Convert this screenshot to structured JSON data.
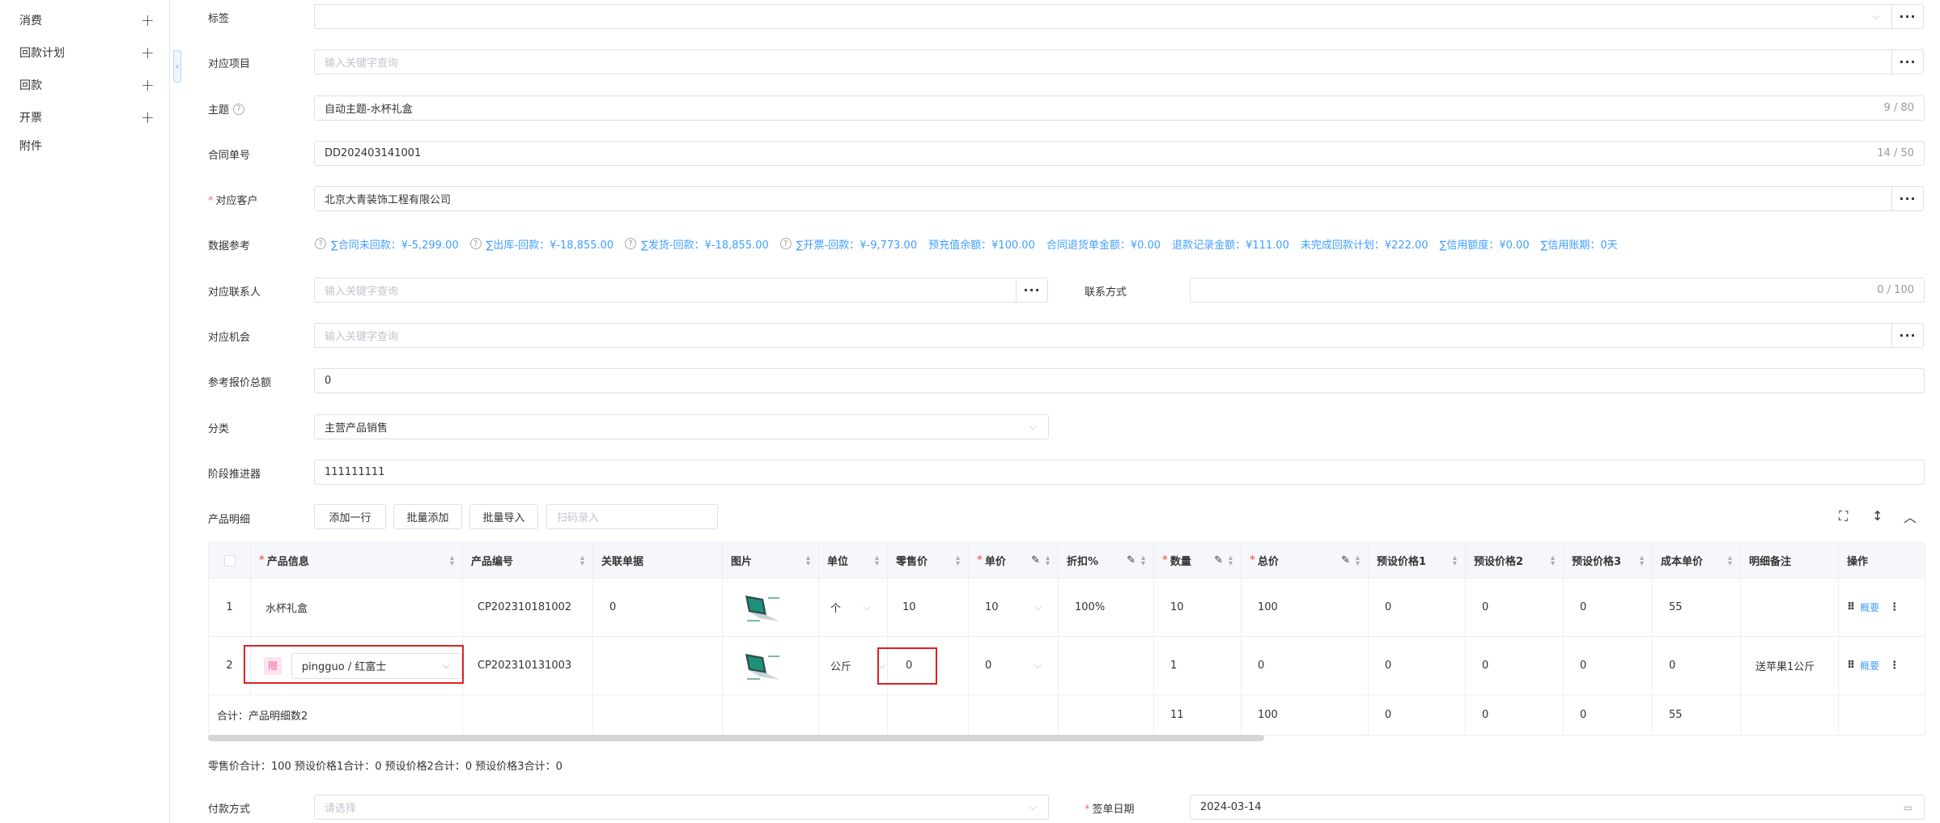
{
  "sidebar": {
    "items": [
      {
        "label": "消费",
        "has_plus": true
      },
      {
        "label": "回款计划",
        "has_plus": true
      },
      {
        "label": "回款",
        "has_plus": true
      },
      {
        "label": "开票",
        "has_plus": true
      },
      {
        "label": "附件",
        "has_plus": false
      }
    ],
    "collapse_glyph": "‹"
  },
  "form": {
    "tag": {
      "label": "标签",
      "value": ""
    },
    "project": {
      "label": "对应项目",
      "placeholder": "输入关键字查询"
    },
    "subject": {
      "label": "主题",
      "value": "自动主题-水杯礼盒",
      "count": "9 / 80"
    },
    "contract_no": {
      "label": "合同单号",
      "value": "DD202403141001",
      "count": "14 / 50"
    },
    "customer": {
      "label": "对应客户",
      "value": "北京大青装饰工程有限公司"
    },
    "data_ref": {
      "label": "数据参考",
      "items": [
        {
          "text": "∑合同未回款：¥-5,299.00",
          "help": true
        },
        {
          "text": "∑出库-回款：¥-18,855.00",
          "help": true
        },
        {
          "text": "∑发货-回款：¥-18,855.00",
          "help": true
        },
        {
          "text": "∑开票-回款：¥-9,773.00",
          "help": true
        },
        {
          "text": "预充值余额：¥100.00",
          "help": false
        },
        {
          "text": "合同退货单金额：¥0.00",
          "help": false
        },
        {
          "text": "退款记录金额：¥111.00",
          "help": false
        },
        {
          "text": "未完成回款计划：¥222.00",
          "help": false
        },
        {
          "text": "∑信用额度：¥0.00",
          "help": false
        },
        {
          "text": "∑信用账期：0天",
          "help": false
        }
      ]
    },
    "contact": {
      "label": "对应联系人",
      "placeholder": "输入关键字查询"
    },
    "contact_method": {
      "label": "联系方式",
      "value": "",
      "count": "0 / 100"
    },
    "opportunity": {
      "label": "对应机会",
      "placeholder": "输入关键字查询"
    },
    "ref_quote_total": {
      "label": "参考报价总额",
      "value": "0"
    },
    "category": {
      "label": "分类",
      "value": "主营产品销售"
    },
    "stage": {
      "label": "阶段推进器",
      "value": "111111111"
    },
    "products_label": "产品明细",
    "payment": {
      "label": "付款方式",
      "placeholder": "请选择"
    },
    "sign_date": {
      "label": "签单日期",
      "value": "2024-03-14"
    }
  },
  "toolbar": {
    "add_row": "添加一行",
    "batch_add": "批量添加",
    "batch_import": "批量导入",
    "scan_placeholder": "扫码录入"
  },
  "table": {
    "headers": {
      "product_info": "产品信息",
      "product_code": "产品编号",
      "related_doc": "关联单据",
      "image": "图片",
      "unit": "单位",
      "retail_price": "零售价",
      "unit_price": "单价",
      "discount": "折扣%",
      "quantity": "数量",
      "total": "总价",
      "preset1": "预设价格1",
      "preset2": "预设价格2",
      "preset3": "预设价格3",
      "cost_unit": "成本单价",
      "remark": "明细备注",
      "actions": "操作"
    },
    "rows": [
      {
        "no": "1",
        "product": "水杯礼盒",
        "code": "CP202310181002",
        "related": "0",
        "unit": "个",
        "retail": "10",
        "price": "10",
        "discount": "100%",
        "qty": "10",
        "total": "100",
        "p1": "0",
        "p2": "0",
        "p3": "0",
        "cost": "55",
        "remark": "",
        "op": "概要"
      },
      {
        "no": "2",
        "gift_tag": "赠",
        "product": "pingguo / 红富士",
        "code": "CP202310131003",
        "related": "",
        "unit": "公斤",
        "retail": "0",
        "price": "0",
        "discount": "",
        "qty": "1",
        "total": "0",
        "p1": "0",
        "p2": "0",
        "p3": "0",
        "cost": "0",
        "remark": "送苹果1公斤",
        "op": "概要"
      }
    ],
    "footer": {
      "label": "合计：产品明细数2",
      "qty": "11",
      "total": "100",
      "p1": "0",
      "p2": "0",
      "p3": "0",
      "cost": "55"
    },
    "summary": "零售价合计：100  预设价格1合计：0  预设价格2合计：0  预设价格3合计：0"
  }
}
